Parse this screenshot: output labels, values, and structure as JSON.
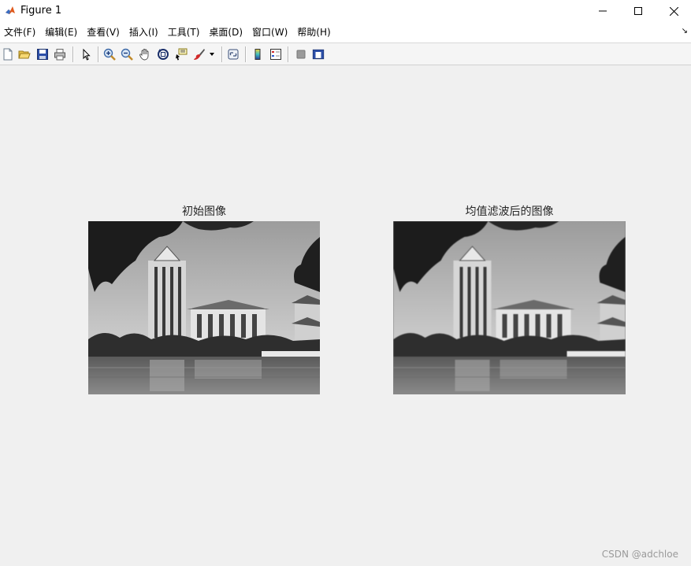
{
  "window": {
    "title": "Figure 1"
  },
  "menu": {
    "items": [
      {
        "label": "文件(F)"
      },
      {
        "label": "编辑(E)"
      },
      {
        "label": "查看(V)"
      },
      {
        "label": "插入(I)"
      },
      {
        "label": "工具(T)"
      },
      {
        "label": "桌面(D)"
      },
      {
        "label": "窗口(W)"
      },
      {
        "label": "帮助(H)"
      }
    ]
  },
  "toolbar": {
    "buttons": [
      "new-figure-icon",
      "open-file-icon",
      "save-icon",
      "print-icon",
      "edit-plot-arrow-icon",
      "zoom-in-icon",
      "zoom-out-icon",
      "pan-hand-icon",
      "rotate-3d-icon",
      "data-cursor-icon",
      "brush-icon",
      "dropdown-arrow-icon",
      "link-plot-icon",
      "colorbar-icon",
      "legend-icon",
      "hide-plot-tools-icon",
      "show-plot-tools-icon"
    ]
  },
  "figure": {
    "left_title": "初始图像",
    "right_title": "均值滤波后的图像"
  },
  "watermark": "CSDN @adchloe",
  "colors": {
    "background": "#f0f0f0",
    "titlebar": "#ffffff",
    "title_text": "#262626"
  }
}
